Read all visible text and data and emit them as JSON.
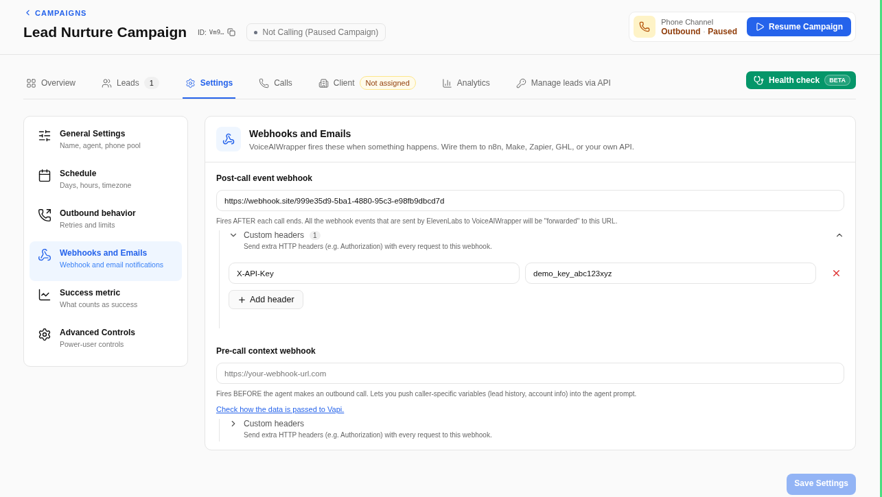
{
  "back_link": "CAMPAIGNS",
  "title": "Lead Nurture Campaign",
  "id": {
    "label": "ID:",
    "value": "Vm9…"
  },
  "status": {
    "text": "Not Calling (Paused Campaign)"
  },
  "channel": {
    "label": "Phone Channel",
    "direction": "Outbound",
    "separator": "·",
    "state": "Paused"
  },
  "resume_button": "Resume Campaign",
  "tabs": [
    {
      "label": "Overview",
      "selected": false
    },
    {
      "label": "Leads",
      "selected": false,
      "count": "1"
    },
    {
      "label": "Settings",
      "selected": true
    },
    {
      "label": "Calls",
      "selected": false
    },
    {
      "label": "Client",
      "selected": false,
      "status": "Not assigned"
    },
    {
      "label": "Analytics",
      "selected": false
    },
    {
      "label": "Manage leads via API",
      "selected": false
    }
  ],
  "health_check": {
    "label": "Health check",
    "badge": "BETA"
  },
  "sidebar": {
    "items": [
      {
        "title": "General Settings",
        "subtitle": "Name, agent, phone pool",
        "selected": false
      },
      {
        "title": "Schedule",
        "subtitle": "Days, hours, timezone",
        "selected": false
      },
      {
        "title": "Outbound behavior",
        "subtitle": "Retries and limits",
        "selected": false
      },
      {
        "title": "Webhooks and Emails",
        "subtitle": "Webhook and email notifications",
        "selected": true
      },
      {
        "title": "Success metric",
        "subtitle": "What counts as success",
        "selected": false
      },
      {
        "title": "Advanced Controls",
        "subtitle": "Power-user controls",
        "selected": false
      }
    ]
  },
  "panel": {
    "title": "Webhooks and Emails",
    "description": "VoiceAIWrapper fires these when something happens. Wire them to n8n, Make, Zapier, GHL, or your own API.",
    "sections": [
      {
        "label": "Post-call event webhook",
        "field": {
          "value": "https://webhook.site/999e35d9-5ba1-4880-95c3-e98fb9dbcd7d"
        },
        "help": "Fires AFTER each call ends. All the webhook events that are sent by ElevenLabs to VoiceAIWrapper will be \"forwarded\" to this URL.",
        "custom_headers": {
          "label": "Custom headers",
          "count": "1",
          "description": "Send extra HTTP headers (e.g. Authorization) with every request to this webhook.",
          "expanded": true,
          "headers": [
            {
              "name": "X-API-Key",
              "value": "demo_key_abc123xyz"
            }
          ],
          "add_button": "Add header"
        }
      },
      {
        "label": "Pre-call context webhook",
        "field": {
          "placeholder": "https://your-webhook-url.com"
        },
        "help": "Fires BEFORE the agent makes an outbound call. Lets you push caller-specific variables (lead history, account info) into the agent prompt.",
        "link": "Check how the data is passed to Vapi.",
        "custom_headers": {
          "label": "Custom headers",
          "description": "Send extra HTTP headers (e.g. Authorization) with every request to this webhook.",
          "expanded": false
        }
      }
    ]
  },
  "save_button": {
    "label": "Save Settings",
    "disabled": true
  }
}
